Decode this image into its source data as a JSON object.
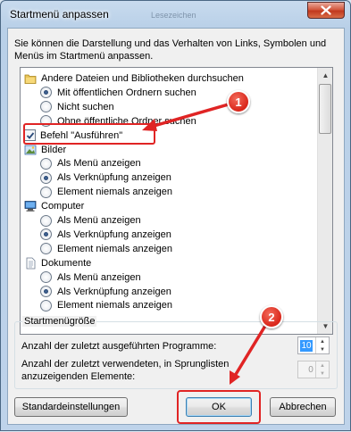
{
  "window": {
    "title": "Startmenü anpassen",
    "ghost_tab": "Lesezeichen",
    "close_icon": "close-icon"
  },
  "description": "Sie können die Darstellung und das Verhalten von Links, Symbolen und Menüs im Startmenü anpassen.",
  "options_list": {
    "rows": [
      {
        "kind": "category",
        "icon": "folder-icon",
        "label": "Andere Dateien und Bibliotheken durchsuchen"
      },
      {
        "kind": "radio",
        "checked": true,
        "label": "Mit öffentlichen Ordnern suchen"
      },
      {
        "kind": "radio",
        "checked": false,
        "label": "Nicht suchen"
      },
      {
        "kind": "radio",
        "checked": false,
        "label": "Ohne öffentliche Ordner suchen"
      },
      {
        "kind": "checkbox",
        "checked": true,
        "label": "Befehl \"Ausführen\""
      },
      {
        "kind": "category",
        "icon": "pictures-icon",
        "label": "Bilder"
      },
      {
        "kind": "radio",
        "checked": false,
        "label": "Als Menü anzeigen"
      },
      {
        "kind": "radio",
        "checked": true,
        "label": "Als Verknüpfung anzeigen"
      },
      {
        "kind": "radio",
        "checked": false,
        "label": "Element niemals anzeigen"
      },
      {
        "kind": "category",
        "icon": "computer-icon",
        "label": "Computer"
      },
      {
        "kind": "radio",
        "checked": false,
        "label": "Als Menü anzeigen"
      },
      {
        "kind": "radio",
        "checked": true,
        "label": "Als Verknüpfung anzeigen"
      },
      {
        "kind": "radio",
        "checked": false,
        "label": "Element niemals anzeigen"
      },
      {
        "kind": "category",
        "icon": "documents-icon",
        "label": "Dokumente"
      },
      {
        "kind": "radio",
        "checked": false,
        "label": "Als Menü anzeigen"
      },
      {
        "kind": "radio",
        "checked": true,
        "label": "Als Verknüpfung anzeigen"
      },
      {
        "kind": "radio",
        "checked": false,
        "label": "Element niemals anzeigen"
      }
    ]
  },
  "size_group": {
    "label": "Startmenügröße",
    "recent_programs_label": "Anzahl der zuletzt ausgeführten Programme:",
    "recent_programs_value": "10",
    "jumplist_label_line1": "Anzahl der zuletzt verwendeten, in Sprunglisten",
    "jumplist_label_line2": "anzuzeigenden Elemente:",
    "jumplist_value": "0"
  },
  "buttons": {
    "defaults": "Standardeinstellungen",
    "ok": "OK",
    "cancel": "Abbrechen"
  },
  "annotations": {
    "badge1": "1",
    "badge2": "2",
    "color": "#e02424"
  }
}
